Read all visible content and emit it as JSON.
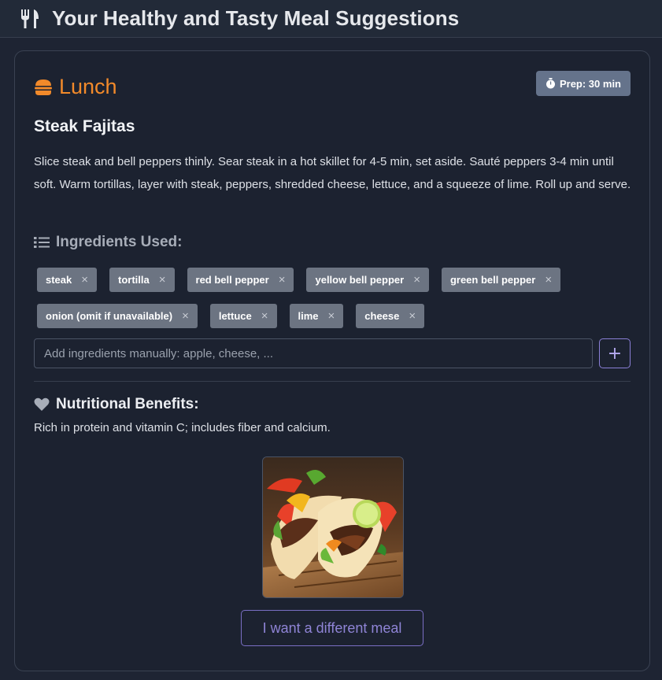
{
  "header": {
    "title": "Your Healthy and Tasty Meal Suggestions",
    "icon": "fork-knife-icon"
  },
  "meal": {
    "type": "Lunch",
    "type_icon": "burger-icon",
    "prep": "Prep: 30 min",
    "name": "Steak Fajitas",
    "description": "Slice steak and bell peppers thinly. Sear steak in a hot skillet for 4-5 min, set aside. Sauté peppers 3-4 min until soft. Warm tortillas, layer with steak, peppers, shredded cheese, lettuce, and a squeeze of lime. Roll up and serve."
  },
  "ingredients": {
    "heading": "Ingredients Used:",
    "items": [
      {
        "label": "steak"
      },
      {
        "label": "tortilla"
      },
      {
        "label": "red bell pepper"
      },
      {
        "label": "yellow bell pepper"
      },
      {
        "label": "green bell pepper"
      },
      {
        "label": "onion (omit if unavailable)"
      },
      {
        "label": "lettuce"
      },
      {
        "label": "lime"
      },
      {
        "label": "cheese"
      }
    ],
    "remove_symbol": "×",
    "input_placeholder": "Add ingredients manually: apple, cheese, ...",
    "add_symbol": "+"
  },
  "nutrition": {
    "heading": "Nutritional Benefits:",
    "text": "Rich in protein and vitamin C; includes fiber and calcium."
  },
  "actions": {
    "different_meal": "I want a different meal"
  },
  "colors": {
    "accent_orange": "#f28a2a",
    "accent_purple": "#8a7fd6",
    "tag_bg": "#6c7482",
    "badge_bg": "#65738b"
  }
}
